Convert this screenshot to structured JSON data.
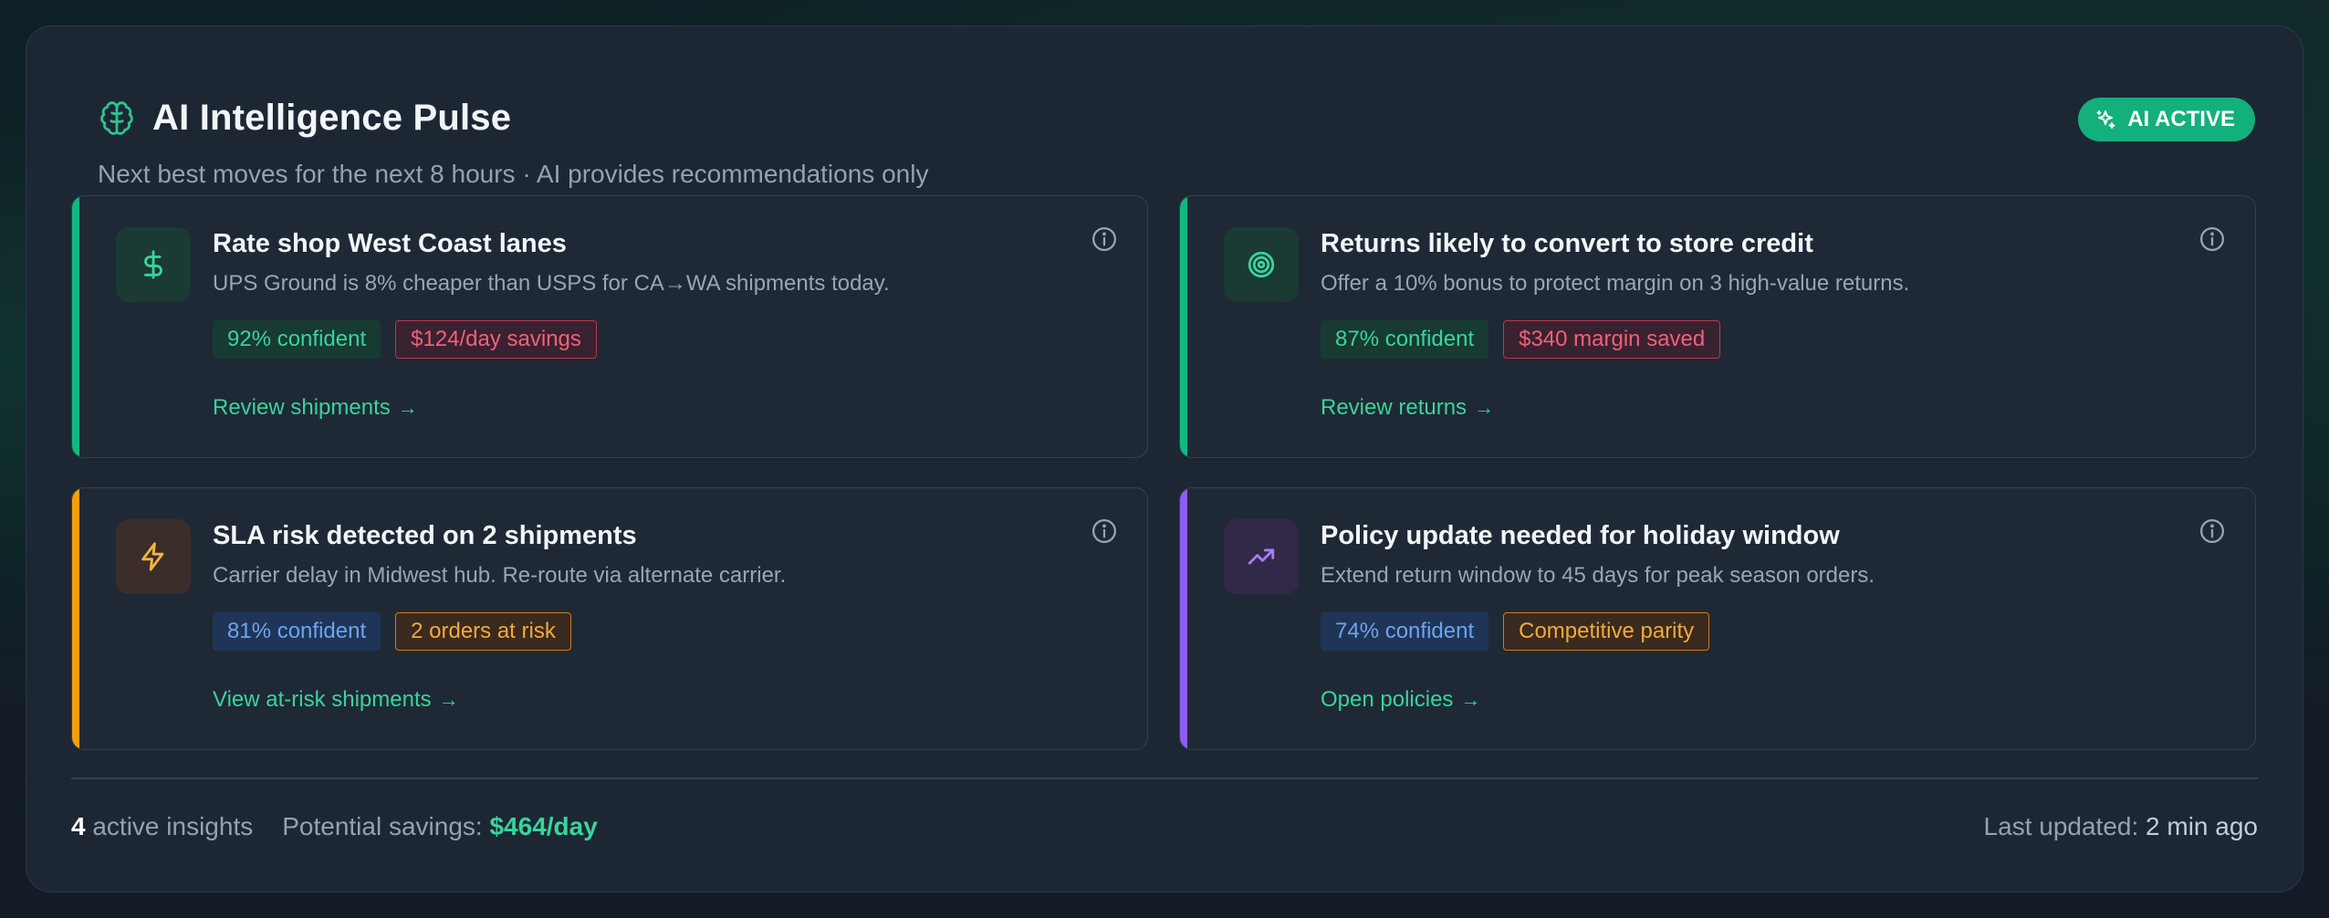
{
  "header": {
    "title": "AI Intelligence Pulse",
    "subtitle": "Next best moves for the next 8 hours · AI provides recommendations only",
    "badge": "AI ACTIVE",
    "icon": "brain-icon"
  },
  "cards": [
    {
      "title": "Rate shop West Coast lanes",
      "description": "UPS Ground is 8% cheaper than USPS for CA→WA shipments today.",
      "confidence": "92% confident",
      "impact": "$124/day savings",
      "link": "Review shipments",
      "icon": "dollar-icon",
      "accent": "#10b981"
    },
    {
      "title": "Returns likely to convert to store credit",
      "description": "Offer a 10% bonus to protect margin on 3 high-value returns.",
      "confidence": "87% confident",
      "impact": "$340 margin saved",
      "link": "Review returns",
      "icon": "target-icon",
      "accent": "#10b981"
    },
    {
      "title": "SLA risk detected on 2 shipments",
      "description": "Carrier delay in Midwest hub. Re-route via alternate carrier.",
      "confidence": "81% confident",
      "impact": "2 orders at risk",
      "link": "View at-risk shipments",
      "icon": "lightning-icon",
      "accent": "#f59e0b"
    },
    {
      "title": "Policy update needed for holiday window",
      "description": "Extend return window to 45 days for peak season orders.",
      "confidence": "74% confident",
      "impact": "Competitive parity",
      "link": "Open policies",
      "icon": "trending-up-icon",
      "accent": "#8b5cf6"
    }
  ],
  "footer": {
    "insights_count": "4",
    "insights_label": "active insights",
    "savings_label": "Potential savings:",
    "savings_value": "$464/day",
    "updated_label": "Last updated:",
    "updated_value": "2 min ago"
  },
  "colors": {
    "brand_green": "#13b07c",
    "text_green": "#3bd39a",
    "warning": "#f59e0b",
    "purple": "#8b5cf6",
    "panel_bg": "#1d2734"
  }
}
